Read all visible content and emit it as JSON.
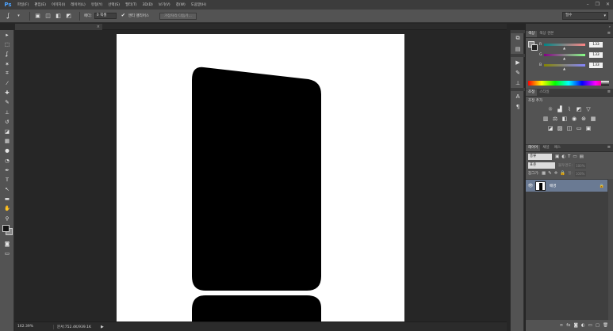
{
  "app": {
    "logo": "Ps"
  },
  "menu": [
    "파일(F)",
    "편집(E)",
    "이미지(I)",
    "레이어(L)",
    "유형(Y)",
    "선택(S)",
    "필터(T)",
    "3D(D)",
    "보기(V)",
    "창(W)",
    "도움말(H)"
  ],
  "window_controls": {
    "minimize": "–",
    "restore": "❐",
    "close": "✕"
  },
  "options_bar": {
    "tool_icon": "lasso-icon",
    "feather_label": "페더:",
    "feather_value": "0 픽셀",
    "antialias_label": "앤티 앨리어스",
    "antialias_checked": true,
    "refine_edge_button": "가장자리 다듬기...",
    "workspace_value": "필수"
  },
  "document_tab": {
    "title": "",
    "close": "×"
  },
  "status_bar": {
    "zoom": "162.39%",
    "doc_info": "문서:752.4K/939.1K",
    "arrow": "▶"
  },
  "color_panel": {
    "tabs": [
      "색상",
      "색상 견본"
    ],
    "channels": [
      {
        "letter": "R",
        "value": "133",
        "gradient": "linear-gradient(to right,#008585,#ff8585)"
      },
      {
        "letter": "G",
        "value": "133",
        "gradient": "linear-gradient(to right,#850085,#85ff85)"
      },
      {
        "letter": "B",
        "value": "133",
        "gradient": "linear-gradient(to right,#858500,#8585ff)"
      }
    ]
  },
  "adjustments_panel": {
    "tabs": [
      "조정",
      "스타일"
    ],
    "title": "조정 추가"
  },
  "layers_panel": {
    "tabs": [
      "레이어",
      "채널",
      "패스"
    ],
    "filter_value": "종류",
    "blend_mode": "표준",
    "opacity_label": "불투명도:",
    "opacity_value": "100%",
    "lock_label": "잠그기:",
    "fill_label": "칠:",
    "fill_value": "100%",
    "layers": [
      {
        "name": "배경",
        "visible": true,
        "locked": true
      }
    ]
  },
  "colors": {
    "canvas_bg": "#ffffff",
    "object": "#000000",
    "app_bg": "#262626",
    "panel_bg": "#535353",
    "selected_layer": "#6a7a93"
  }
}
